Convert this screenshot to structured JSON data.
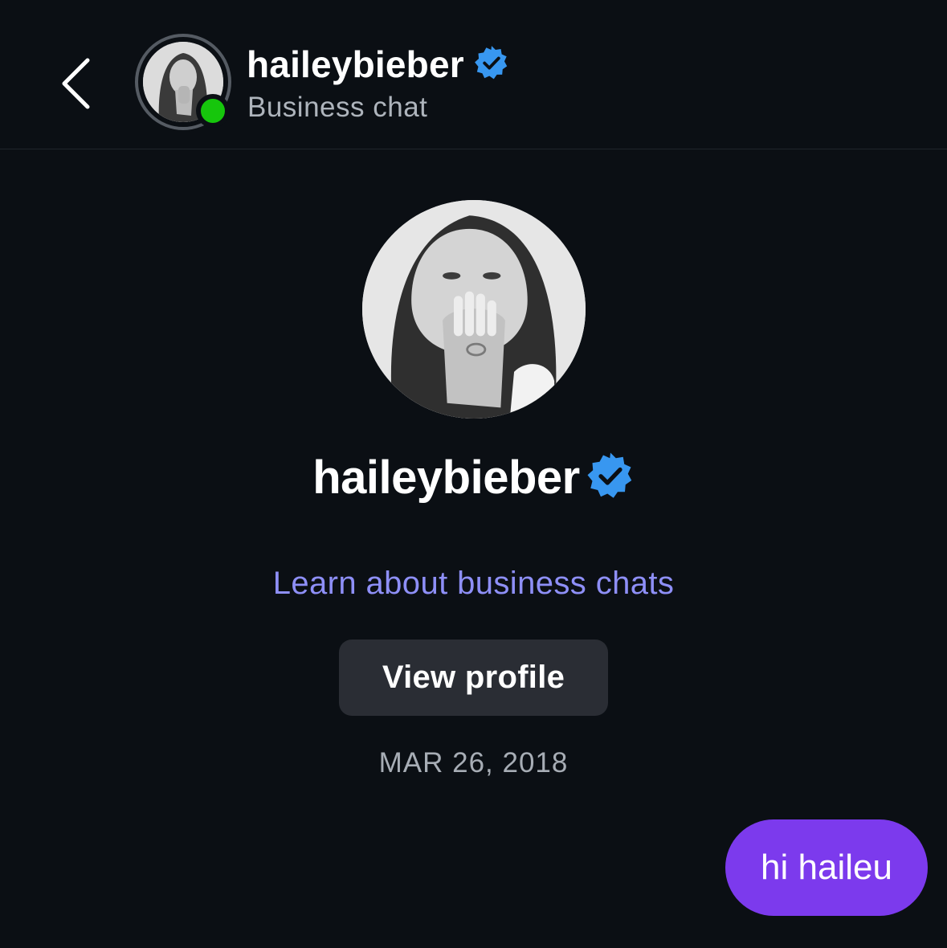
{
  "header": {
    "username": "haileybieber",
    "subtitle": "Business chat",
    "online": true
  },
  "profile": {
    "username": "haileybieber",
    "verified": true,
    "learn_link": "Learn about business chats",
    "view_profile_label": "View profile"
  },
  "chat": {
    "date": "MAR 26, 2018",
    "messages": [
      {
        "from": "me",
        "text": "hi haileu"
      }
    ]
  },
  "colors": {
    "background": "#0b0f14",
    "link": "#8e8ff7",
    "verified_badge": "#3897f0",
    "online_dot": "#16c60c",
    "my_bubble": "#7c3aed",
    "button_bg": "#2a2d34"
  },
  "icons": {
    "back": "chevron-left-icon",
    "verified": "verified-badge-icon"
  }
}
